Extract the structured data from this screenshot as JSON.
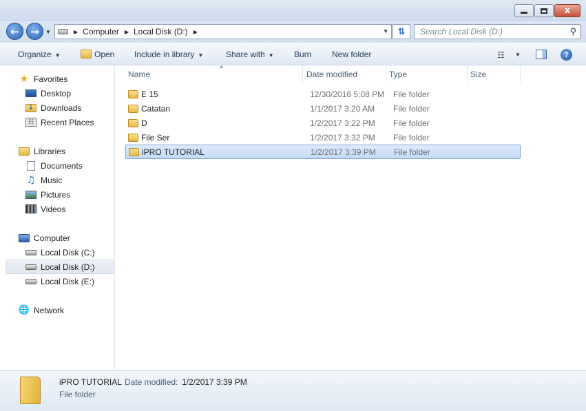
{
  "window": {
    "minimize": "",
    "maximize": "",
    "close": "x"
  },
  "address": {
    "crumbs": [
      "Computer",
      "Local Disk (D:)"
    ],
    "search_placeholder": "Search Local Disk (D:)"
  },
  "toolbar": {
    "organize": "Organize",
    "open": "Open",
    "include_in_library": "Include in library",
    "share_with": "Share with",
    "burn": "Burn",
    "new_folder": "New folder"
  },
  "navpane": {
    "favorites": "Favorites",
    "desktop": "Desktop",
    "downloads": "Downloads",
    "recent_places": "Recent Places",
    "libraries": "Libraries",
    "documents": "Documents",
    "music": "Music",
    "pictures": "Pictures",
    "videos": "Videos",
    "computer": "Computer",
    "local_c": "Local Disk (C:)",
    "local_d": "Local Disk (D:)",
    "local_e": "Local Disk (E:)",
    "network": "Network"
  },
  "columns": {
    "name": "Name",
    "date_modified": "Date modified",
    "type": "Type",
    "size": "Size"
  },
  "files": [
    {
      "name": "E                          15",
      "date": "12/30/2016 5:08 PM",
      "type": "File folder"
    },
    {
      "name": "Catatan",
      "date": "1/1/2017 3:20 AM",
      "type": "File folder"
    },
    {
      "name": "D",
      "date": "1/2/2017 3:22 PM",
      "type": "File folder"
    },
    {
      "name": "File Ser",
      "date": "1/2/2017 3:32 PM",
      "type": "File folder"
    },
    {
      "name": "iPRO TUTORIAL",
      "date": "1/2/2017 3:39 PM",
      "type": "File folder"
    }
  ],
  "details": {
    "name": "iPRO TUTORIAL",
    "date_label": "Date modified:",
    "date_value": "1/2/2017 3:39 PM",
    "type": "File folder"
  }
}
